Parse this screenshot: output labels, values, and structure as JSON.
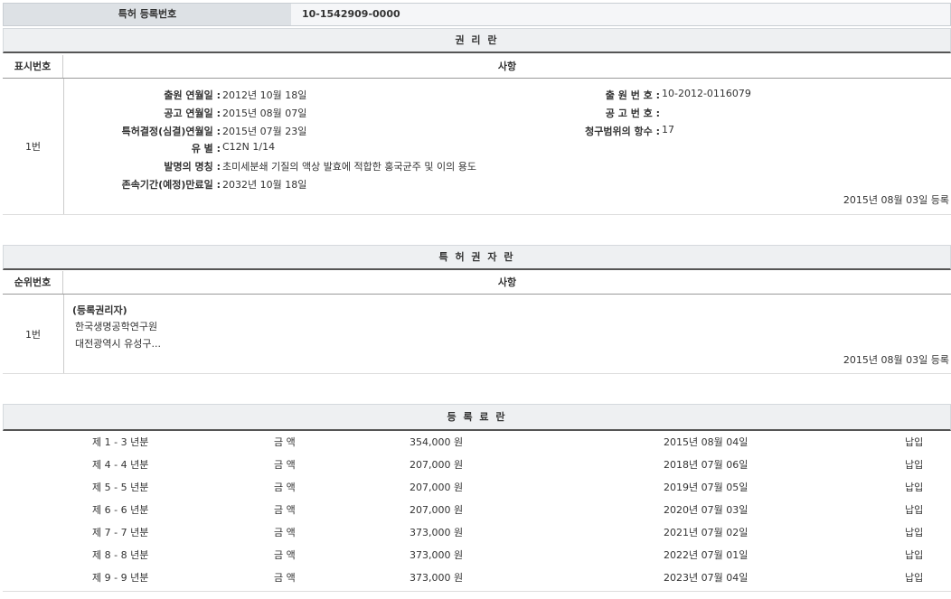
{
  "registration": {
    "label": "특허 등록번호",
    "value": "10-1542909-0000"
  },
  "rights": {
    "title": "권 리 란",
    "col_num": "표시번호",
    "col_item": "사항",
    "row_num": "1번",
    "fields": [
      {
        "label": "출원 연월일 :",
        "value": "2012년 10월 18일"
      },
      {
        "label": "공고 연월일 :",
        "value": "2015년 08월 07일"
      },
      {
        "label": "특허결정(심결)연월일 :",
        "value": "2015년 07월 23일"
      },
      {
        "label": "유 별 :",
        "value": "C12N 1/14"
      },
      {
        "label": "발명의 명칭 :",
        "value": "초미세분쇄 기질의 액상 발효에 적합한 홍국균주 및 이의 용도"
      },
      {
        "label": "존속기간(예정)만료일 :",
        "value": "2032년 10월 18일"
      }
    ],
    "right_fields": [
      {
        "label": "출 원 번 호 :",
        "value": "10-2012-0116079"
      },
      {
        "label": "공 고 번 호 :",
        "value": ""
      },
      {
        "label": "청구범위의 항수 :",
        "value": "17"
      }
    ],
    "reg_date": "2015년 08월 03일 등록"
  },
  "patentee": {
    "title": "특 허 권 자 란",
    "col_num": "순위번호",
    "col_item": "사항",
    "row_num": "1번",
    "role": "(등록권리자)",
    "name": "한국생명공학연구원",
    "address": "대전광역시 유성구...",
    "reg_date": "2015년 08월 03일 등록"
  },
  "fees": {
    "title": "등 록 료 란",
    "rows": [
      {
        "period": "제 1 - 3 년분",
        "label": "금 액",
        "amount": "354,000 원",
        "date": "2015년 08월 04일",
        "status": "납입"
      },
      {
        "period": "제 4 - 4 년분",
        "label": "금 액",
        "amount": "207,000 원",
        "date": "2018년 07월 06일",
        "status": "납입"
      },
      {
        "period": "제 5 - 5 년분",
        "label": "금 액",
        "amount": "207,000 원",
        "date": "2019년 07월 05일",
        "status": "납입"
      },
      {
        "period": "제 6 - 6 년분",
        "label": "금 액",
        "amount": "207,000 원",
        "date": "2020년 07월 03일",
        "status": "납입"
      },
      {
        "period": "제 7 - 7 년분",
        "label": "금 액",
        "amount": "373,000 원",
        "date": "2021년 07월 02일",
        "status": "납입"
      },
      {
        "period": "제 8 - 8 년분",
        "label": "금 액",
        "amount": "373,000 원",
        "date": "2022년 07월 01일",
        "status": "납입"
      },
      {
        "period": "제 9 - 9 년분",
        "label": "금 액",
        "amount": "373,000 원",
        "date": "2023년 07월 04일",
        "status": "납입"
      }
    ]
  }
}
